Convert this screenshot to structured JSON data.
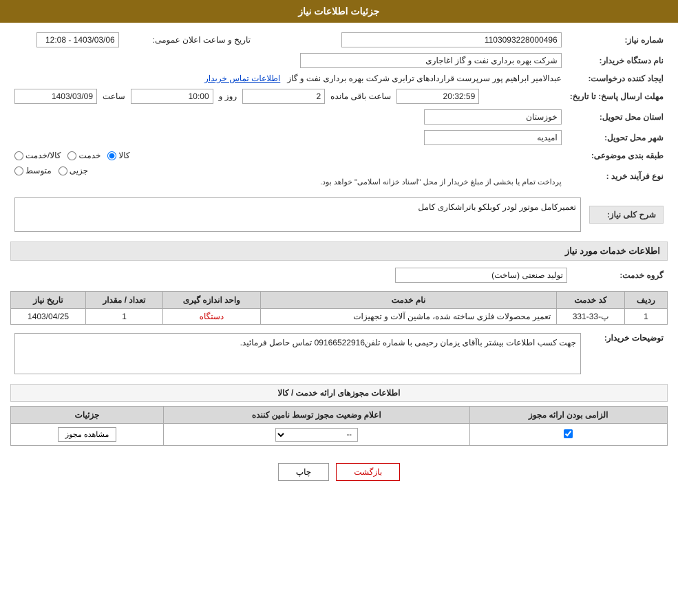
{
  "page": {
    "title": "جزئیات اطلاعات نیاز"
  },
  "header": {
    "announce_label": "تاریخ و ساعت اعلان عمومی:",
    "announce_date": "1403/03/06 - 12:08"
  },
  "fields": {
    "need_number_label": "شماره نیاز:",
    "need_number_value": "1103093228000496",
    "buyer_org_label": "نام دستگاه خریدار:",
    "buyer_org_value": "شرکت بهره برداری نفت و گاز اغاجاری",
    "creator_label": "ایجاد کننده درخواست:",
    "creator_name": "عبدالامیر ابراهیم پور سرپرست قراردادهای ترابری شرکت بهره برداری نفت و گاز",
    "contact_link": "اطلاعات تماس خریدار",
    "deadline_label": "مهلت ارسال پاسخ: تا تاریخ:",
    "deadline_date": "1403/03/09",
    "deadline_time_label": "ساعت",
    "deadline_time": "10:00",
    "deadline_day_label": "روز و",
    "deadline_days": "2",
    "deadline_remaining_label": "ساعت باقی مانده",
    "deadline_remaining": "20:32:59",
    "province_label": "استان محل تحویل:",
    "province_value": "خوزستان",
    "city_label": "شهر محل تحویل:",
    "city_value": "امیدیه",
    "category_label": "طبقه بندی موضوعی:",
    "category_options": [
      "کالا",
      "خدمت",
      "کالا/خدمت"
    ],
    "category_selected": "کالا",
    "purchase_type_label": "نوع فرآیند خرید :",
    "purchase_options": [
      "جزیی",
      "متوسط"
    ],
    "purchase_note": "پرداخت تمام یا بخشی از مبلغ خریدار از محل \"اسناد خزانه اسلامی\" خواهد بود.",
    "general_desc_label": "شرح کلی نیاز:",
    "general_desc_value": "تعمیرکامل موتور لودر کوبلکو باتراشکاری کامل"
  },
  "services_section": {
    "title": "اطلاعات خدمات مورد نیاز",
    "service_group_label": "گروه خدمت:",
    "service_group_value": "تولید صنعتی (ساخت)",
    "table_headers": [
      "ردیف",
      "کد خدمت",
      "نام خدمت",
      "واحد اندازه گیری",
      "تعداد / مقدار",
      "تاریخ نیاز"
    ],
    "table_rows": [
      {
        "row_num": "1",
        "service_code": "پ-33-331",
        "service_name": "تعمیر محصولات فلزی ساخته شده، ماشین آلات و تجهیزات",
        "unit": "دستگاه",
        "quantity": "1",
        "date": "1403/04/25"
      }
    ]
  },
  "buyer_notes": {
    "label": "توضیحات خریدار:",
    "value": "جهت کسب اطلاعات بیشتر باآقای یزمان رحیمی با شماره تلفن09166522916 تماس حاصل فرمائید."
  },
  "permits_section": {
    "title": "اطلاعات مجوزهای ارائه خدمت / کالا",
    "table_headers": [
      "الزامی بودن ارائه مجوز",
      "اعلام وضعیت مجوز توسط نامین کننده",
      "جزئیات"
    ],
    "rows": [
      {
        "required": true,
        "status_options": [
          "--"
        ],
        "status_selected": "--",
        "view_label": "مشاهده مجوز"
      }
    ]
  },
  "buttons": {
    "print": "چاپ",
    "back": "بازگشت"
  }
}
